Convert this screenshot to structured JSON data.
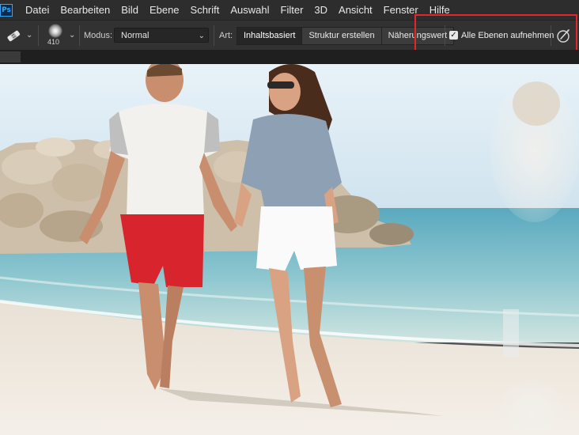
{
  "app": {
    "logo_text": "Ps"
  },
  "menu": {
    "items": [
      "Datei",
      "Bearbeiten",
      "Bild",
      "Ebene",
      "Schrift",
      "Auswahl",
      "Filter",
      "3D",
      "Ansicht",
      "Fenster",
      "Hilfe"
    ]
  },
  "options": {
    "tool_icon": "spot-healing-brush-icon",
    "brush_size": "410",
    "mode_label": "Modus:",
    "mode_value": "Normal",
    "type_label": "Art:",
    "type_options": [
      "Inhaltsbasiert",
      "Struktur erstellen",
      "Näherungswert"
    ],
    "type_selected": "Inhaltsbasiert",
    "sample_all_layers_label": "Alle Ebenen aufnehmen",
    "sample_all_layers_checked": true,
    "pressure_icon": "pressure-size-icon",
    "highlight_color": "#e3262c"
  },
  "colors": {
    "menubar": "#2d2d2d",
    "optionsbar": "#323232",
    "accent": "#31a8ff"
  }
}
